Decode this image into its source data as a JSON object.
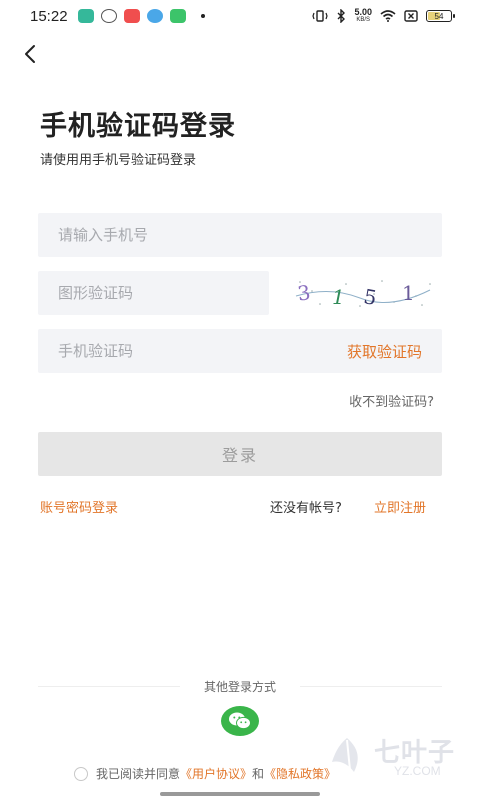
{
  "status_bar": {
    "time": "15:22",
    "net_speed_value": "5.00",
    "net_speed_unit": "KB/S",
    "battery": "54"
  },
  "header": {
    "title": "手机验证码登录",
    "subtitle": "请使用用手机号验证码登录"
  },
  "form": {
    "phone_placeholder": "请输入手机号",
    "captcha_placeholder": "图形验证码",
    "captcha_text": "3 1 5 1",
    "sms_placeholder": "手机验证码",
    "get_code_label": "获取验证码",
    "no_code_label": "收不到验证码?",
    "login_label": "登录"
  },
  "links": {
    "password_login": "账号密码登录",
    "no_account": "还没有帐号?",
    "register": "立即注册"
  },
  "other_login": {
    "label": "其他登录方式",
    "wechat_icon": "wechat-icon"
  },
  "agreement": {
    "prefix": "我已阅读并同意",
    "user_agreement": "《用户协议》",
    "and": "和",
    "privacy_policy": "《隐私政策》"
  },
  "watermark": {
    "text": "七叶子",
    "sub": "YZ.COM"
  },
  "colors": {
    "accent": "#e2762a",
    "field_bg": "#f3f4f7",
    "button_disabled": "#e6e6e6",
    "wechat": "#3ab54a"
  }
}
